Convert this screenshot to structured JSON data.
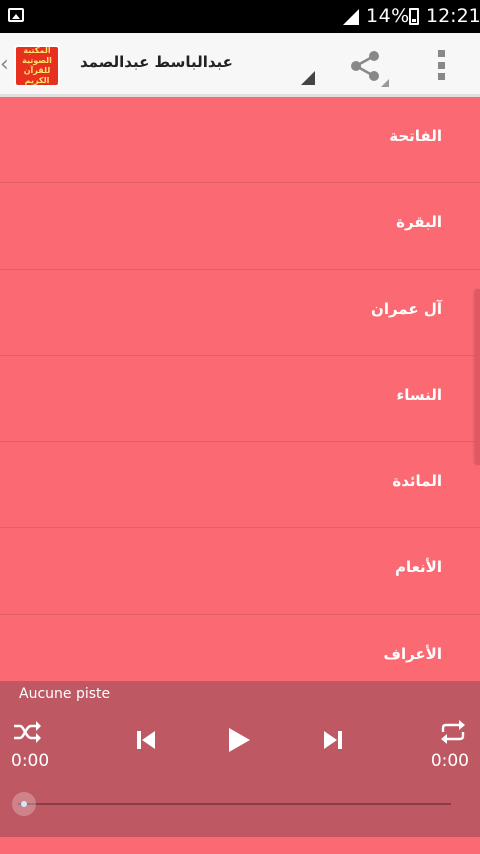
{
  "status_bar": {
    "battery_percent": "14%",
    "time": "12:21"
  },
  "app_bar": {
    "logo_lines": [
      "المكتبة الصوتية",
      "للقرآن",
      "الكريم"
    ],
    "title": "عبدالباسط عبدالصمد"
  },
  "surah_list": [
    "الفاتحة",
    "البقرة",
    "آل عمران",
    "النساء",
    "المائدة",
    "الأنعام",
    "الأعراف"
  ],
  "player": {
    "track_name": "Aucune piste",
    "elapsed": "0:00",
    "duration": "0:00",
    "progress": 0
  },
  "colors": {
    "list_background": "#fb6a72",
    "player_background": "#be5863",
    "app_bar": "#f7f7f7",
    "logo": "#e8301f"
  }
}
